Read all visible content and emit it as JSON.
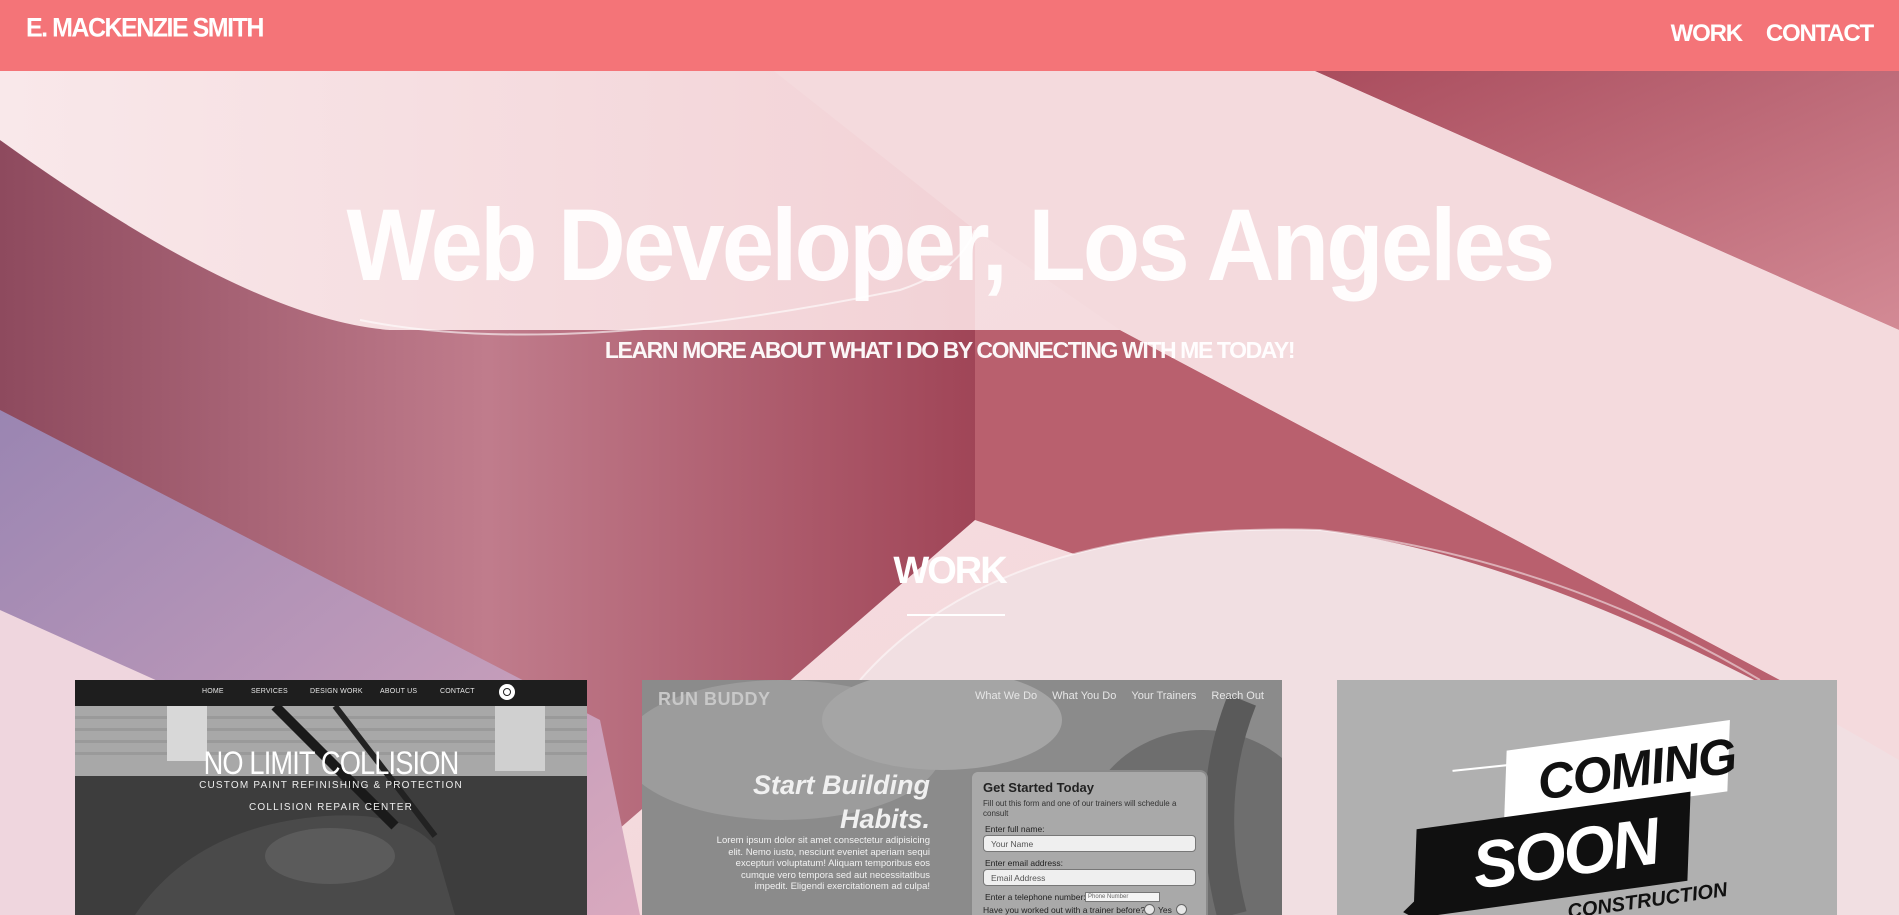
{
  "header": {
    "brand": "E. MACKENZIE SMITH",
    "nav": [
      {
        "label": "WORK"
      },
      {
        "label": "CONTACT"
      }
    ]
  },
  "hero": {
    "title": "Web Developer, Los Angeles",
    "subtitle": "LEARN MORE ABOUT WHAT I DO BY CONNECTING WITH ME TODAY!"
  },
  "work": {
    "heading": "WORK",
    "projects": [
      {
        "nav": [
          "HOME",
          "SERVICES",
          "DESIGN WORK",
          "ABOUT US",
          "CONTACT"
        ],
        "title": "NO LIMIT COLLISION",
        "subtitle": "CUSTOM PAINT REFINISHING & PROTECTION",
        "subtitle2": "COLLISION REPAIR CENTER",
        "icon": "instagram-icon"
      },
      {
        "logo": "RUN BUDDY",
        "nav": [
          "What We Do",
          "What You Do",
          "Your Trainers",
          "Reach Out"
        ],
        "headline_1": "Start Building",
        "headline_2": "Habits.",
        "body": "Lorem ipsum dolor sit amet consectetur adipisicing elit. Nemo iusto, nesciunt eveniet aperiam sequi excepturi voluptatum! Aliquam temporibus eos cumque vero tempora sed aut necessitatibus impedit. Eligendi exercitationem ad culpa!",
        "form": {
          "title": "Get Started Today",
          "note": "Fill out this form and one of our trainers will schedule a consult",
          "name_label": "Enter full name:",
          "name_placeholder": "Your Name",
          "email_label": "Enter email address:",
          "email_placeholder": "Email Address",
          "phone_label": "Enter a telephone number:",
          "phone_placeholder": "Phone Number",
          "trainer_question": "Have you worked out with a trainer before?",
          "yes_label": "Yes"
        }
      },
      {
        "coming": "COMING",
        "soon": "SOON",
        "under": "CONSTRUCTION"
      }
    ]
  },
  "colors": {
    "header_bg": "#f47478",
    "hero_pink": "#f8e2e4",
    "hero_rose": "#a8465a",
    "hero_lilac": "#b79ab9"
  }
}
